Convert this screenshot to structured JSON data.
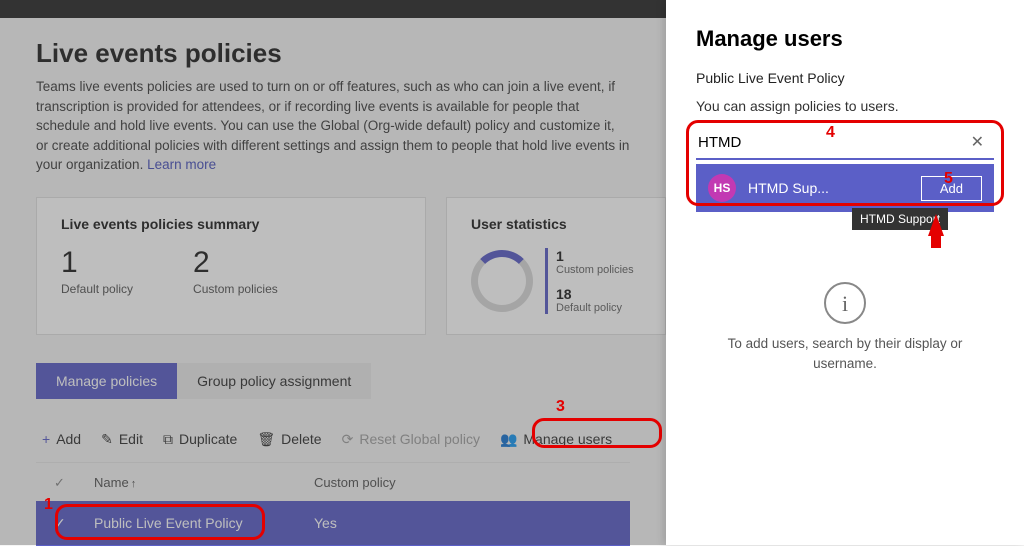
{
  "page": {
    "title": "Live events policies",
    "intro": "Teams live events policies are used to turn on or off features, such as who can join a live event, if transcription is provided for attendees, or if recording live events is available for people that schedule and hold live events. You can use the Global (Org-wide default) policy and customize it, or create additional policies with different settings and assign them to people that hold live events in your organization. ",
    "learn_more": "Learn more"
  },
  "summary": {
    "title": "Live events policies summary",
    "default_num": "1",
    "default_lab": "Default policy",
    "custom_num": "2",
    "custom_lab": "Custom policies"
  },
  "stats": {
    "title": "User statistics",
    "a_num": "1",
    "a_lab": "Custom policies",
    "b_num": "18",
    "b_lab": "Default policy"
  },
  "tabs": {
    "manage": "Manage policies",
    "group": "Group policy assignment"
  },
  "tools": {
    "add": "Add",
    "edit": "Edit",
    "dup": "Duplicate",
    "del": "Delete",
    "reset": "Reset Global policy",
    "manage_users": "Manage users"
  },
  "table": {
    "col_name": "Name",
    "col_custom": "Custom policy",
    "row_name": "Public Live Event Policy",
    "row_custom": "Yes"
  },
  "panel": {
    "title": "Manage users",
    "sub": "Public Live Event Policy",
    "desc": "You can assign policies to users.",
    "search_value": "HTMD",
    "result_initials": "HS",
    "result_name": "HTMD Sup...",
    "add_btn": "Add",
    "tooltip": "HTMD Support",
    "hint": "To add users, search by their display or username."
  },
  "ann": {
    "n1": "1",
    "n3": "3",
    "n4": "4",
    "n5": "5"
  }
}
